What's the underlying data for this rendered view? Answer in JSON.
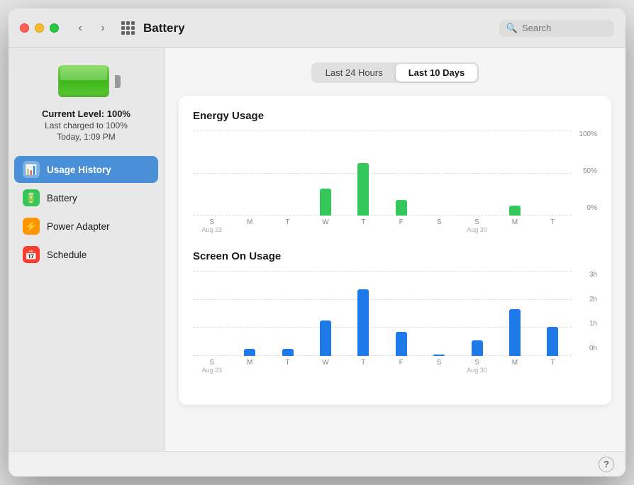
{
  "window": {
    "title": "Battery",
    "search_placeholder": "Search"
  },
  "titlebar": {
    "back_label": "‹",
    "forward_label": "›"
  },
  "battery_status": {
    "level_text": "Current Level: 100%",
    "charged_text": "Last charged to 100%",
    "time_text": "Today, 1:09 PM"
  },
  "sidebar": {
    "items": [
      {
        "id": "usage-history",
        "label": "Usage History",
        "icon": "📊",
        "icon_color": "blue",
        "active": true
      },
      {
        "id": "battery",
        "label": "Battery",
        "icon": "🔋",
        "icon_color": "green",
        "active": false
      },
      {
        "id": "power-adapter",
        "label": "Power Adapter",
        "icon": "⚡",
        "icon_color": "orange",
        "active": false
      },
      {
        "id": "schedule",
        "label": "Schedule",
        "icon": "📅",
        "icon_color": "red",
        "active": false
      }
    ]
  },
  "tabs": [
    {
      "id": "last24h",
      "label": "Last 24 Hours",
      "active": false
    },
    {
      "id": "last10d",
      "label": "Last 10 Days",
      "active": true
    }
  ],
  "energy_chart": {
    "title": "Energy Usage",
    "y_labels": [
      "100%",
      "50%",
      "0%"
    ],
    "bars": [
      {
        "day": "S",
        "date": "Aug 23",
        "height_pct": 0,
        "show_date": true
      },
      {
        "day": "M",
        "height_pct": 0,
        "show_date": false
      },
      {
        "day": "T",
        "height_pct": 0,
        "show_date": false
      },
      {
        "day": "W",
        "height_pct": 32,
        "show_date": false
      },
      {
        "day": "T",
        "height_pct": 62,
        "show_date": false
      },
      {
        "day": "F",
        "height_pct": 18,
        "show_date": false
      },
      {
        "day": "S",
        "height_pct": 0,
        "show_date": false
      },
      {
        "day": "S",
        "date": "Aug 30",
        "height_pct": 0,
        "show_date": true
      },
      {
        "day": "M",
        "height_pct": 12,
        "show_date": false
      },
      {
        "day": "T",
        "height_pct": 0,
        "show_date": false
      }
    ]
  },
  "screen_chart": {
    "title": "Screen On Usage",
    "y_labels": [
      "3h",
      "2h",
      "1h",
      "0h"
    ],
    "bars": [
      {
        "day": "S",
        "date": "Aug 23",
        "height_pct": 0,
        "show_date": true
      },
      {
        "day": "M",
        "height_pct": 8,
        "show_date": false
      },
      {
        "day": "T",
        "height_pct": 8,
        "show_date": false
      },
      {
        "day": "W",
        "height_pct": 42,
        "show_date": false
      },
      {
        "day": "T",
        "height_pct": 78,
        "show_date": false
      },
      {
        "day": "F",
        "height_pct": 28,
        "show_date": false
      },
      {
        "day": "S",
        "height_pct": 2,
        "show_date": false
      },
      {
        "day": "S",
        "date": "Aug 30",
        "height_pct": 18,
        "show_date": true
      },
      {
        "day": "M",
        "height_pct": 55,
        "show_date": false
      },
      {
        "day": "T",
        "height_pct": 34,
        "show_date": false
      }
    ]
  },
  "help_label": "?"
}
